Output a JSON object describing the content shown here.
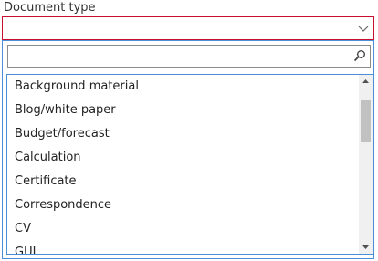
{
  "field": {
    "label": "Document type",
    "selected_value": ""
  },
  "search": {
    "value": "",
    "placeholder": ""
  },
  "options": [
    "Background material",
    "Blog/white paper",
    "Budget/forecast",
    "Calculation",
    "Certificate",
    "Correspondence",
    "CV",
    "GUI"
  ],
  "colors": {
    "select_border": "#c8102e",
    "dropdown_border": "#4a90d9",
    "scrollbar_track": "#f0f0f0",
    "scrollbar_thumb": "#c1c1c1"
  },
  "icons": {
    "select": "chevron-down-icon",
    "search": "search-icon",
    "scroll_up": "arrow-up-icon",
    "scroll_down": "arrow-down-icon"
  }
}
